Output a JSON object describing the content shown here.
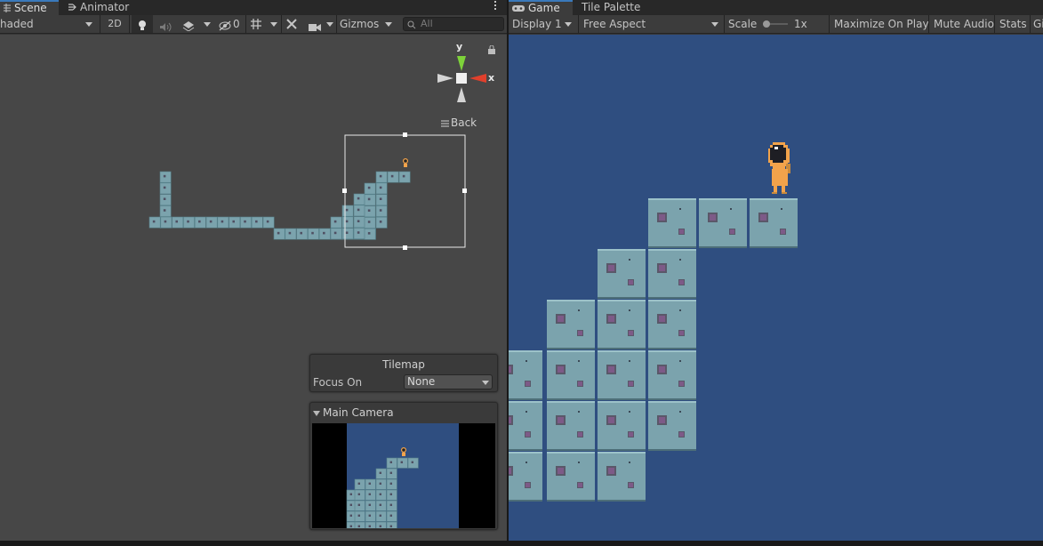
{
  "scene": {
    "tabs": [
      {
        "label": "Scene",
        "icon": "grid-icon"
      },
      {
        "label": "Animator",
        "icon": "animator-icon"
      }
    ],
    "toolbar": {
      "shading_mode": "haded",
      "toggle_2d": "2D",
      "hidden_count": "0",
      "gizmos_label": "Gizmos",
      "search_placeholder": "All"
    },
    "gizmo": {
      "y_label": "y",
      "x_label": "x",
      "view_label": "Back"
    },
    "tilemap_overlay": {
      "title": "Tilemap",
      "focus_label": "Focus On",
      "focus_value": "None"
    },
    "camera_preview": {
      "title": "Main Camera"
    }
  },
  "game": {
    "tabs": [
      {
        "label": "Game",
        "icon": "gamepad-icon"
      },
      {
        "label": "Tile Palette",
        "icon": ""
      }
    ],
    "toolbar": {
      "display": "Display 1",
      "aspect": "Free Aspect",
      "scale_label": "Scale",
      "scale_value": "1x",
      "maximize": "Maximize On Play",
      "mute": "Mute Audio",
      "stats": "Stats",
      "gizmos_cut": "Gi"
    }
  },
  "colors": {
    "game_background": "#2f4e80",
    "scene_background": "#474747",
    "tile_fill": "#7ba3ad",
    "player_orange": "#f2a34b",
    "axis_x": "#e0402c",
    "axis_y": "#7ed33a",
    "active_tab_accent": "#3a79bb"
  }
}
